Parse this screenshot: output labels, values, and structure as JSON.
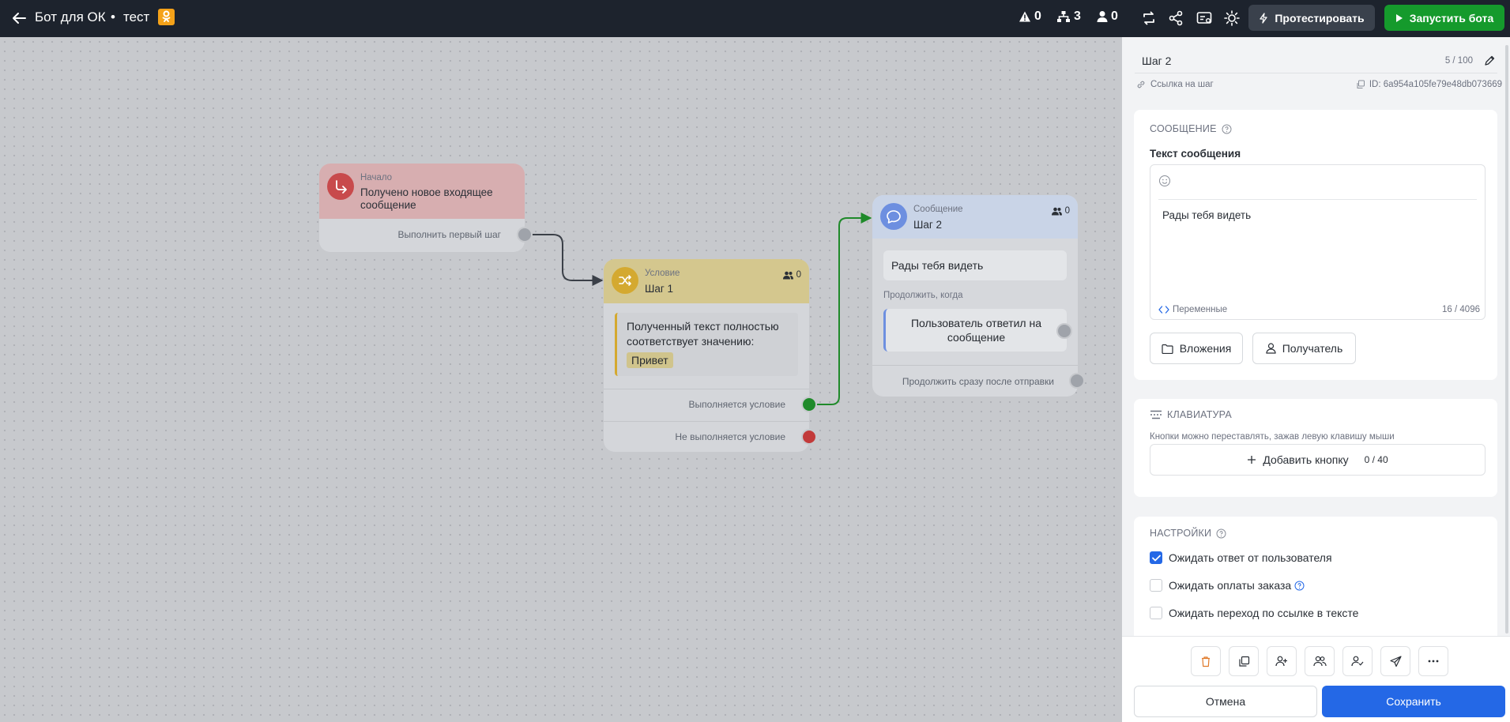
{
  "topbar": {
    "title": "Бот для ОК",
    "separator": "•",
    "subtitle": "тест",
    "platform_badge": "ок",
    "stats": {
      "warnings": "0",
      "steps": "3",
      "users": "0"
    },
    "test_button": "Протестировать",
    "run_button": "Запустить бота"
  },
  "canvas": {
    "start_node": {
      "kind": "Начало",
      "name": "Получено новое входящее сообщение",
      "port_label": "Выполнить первый шаг"
    },
    "condition_node": {
      "kind": "Условие",
      "name": "Шаг 1",
      "users": "0",
      "condition_text": "Полученный текст полностью соответствует значению:",
      "condition_value": "Привет",
      "port_true": "Выполняется условие",
      "port_false": "Не выполняется условие"
    },
    "message_node": {
      "kind": "Сообщение",
      "name": "Шаг 2",
      "users": "0",
      "message": "Рады тебя видеть",
      "continue_when": "Продолжить, когда",
      "reply_condition": "Пользователь ответил на сообщение",
      "after_send": "Продолжить сразу после отправки"
    }
  },
  "panel": {
    "step_name": "Шаг 2",
    "step_name_counter": "5 / 100",
    "step_link": "Ссылка на шаг",
    "step_id": "ID: 6a954a105fe79e48db073669",
    "message_section": {
      "title": "СООБЩЕНИЕ",
      "text_label": "Текст сообщения",
      "text_value": "Рады тебя видеть",
      "variables": "Переменные",
      "char_count": "16 / 4096",
      "attachments_button": "Вложения",
      "recipient_button": "Получатель"
    },
    "keyboard_section": {
      "title": "КЛАВИАТУРА",
      "hint": "Кнопки можно переставлять, зажав левую клавишу мыши",
      "add_button": "Добавить кнопку",
      "button_count": "0 / 40"
    },
    "settings_section": {
      "title": "НАСТРОЙКИ",
      "options": [
        {
          "label": "Ожидать ответ от пользователя",
          "checked": true
        },
        {
          "label": "Ожидать оплаты заказа",
          "checked": false
        },
        {
          "label": "Ожидать переход по ссылке в тексте",
          "checked": false
        }
      ]
    },
    "footer": {
      "cancel": "Отмена",
      "save": "Сохранить"
    }
  },
  "colors": {
    "topbar_bg": "#1d232d",
    "run_green": "#159a2c",
    "save_blue": "#2468e6",
    "edge_green": "#1f8a2a",
    "port_red": "#c23a3a"
  }
}
